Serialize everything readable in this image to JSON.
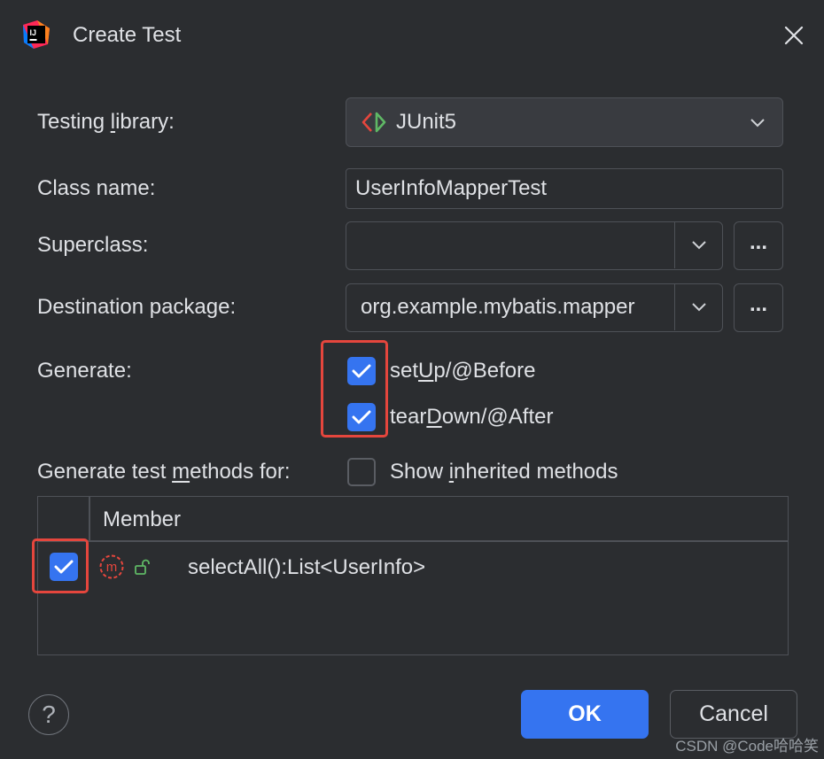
{
  "window": {
    "title": "Create Test"
  },
  "form": {
    "testing_library": {
      "label_pre": "Testing ",
      "label_u": "l",
      "label_post": "ibrary:",
      "value": "JUnit5"
    },
    "class_name": {
      "label": "Class name:",
      "value": "UserInfoMapperTest"
    },
    "superclass": {
      "label": "Superclass:",
      "value": "",
      "browse": "..."
    },
    "destination_package": {
      "label": "Destination package:",
      "value": "org.example.mybatis.mapper",
      "browse": "..."
    },
    "generate": {
      "label": "Generate:",
      "setup": {
        "pre": "set",
        "u": "U",
        "post": "p/@Before",
        "checked": true
      },
      "teardown": {
        "pre": "tear",
        "u": "D",
        "post": "own/@After",
        "checked": true
      }
    },
    "methods_for": {
      "label_pre": "Generate test ",
      "label_u": "m",
      "label_post": "ethods for:",
      "show_inherited": {
        "pre": "Show ",
        "u": "i",
        "post": "nherited methods",
        "checked": false
      }
    }
  },
  "table": {
    "header": "Member",
    "rows": [
      {
        "member": "selectAll():List<UserInfo>",
        "checked": true
      }
    ]
  },
  "buttons": {
    "ok": "OK",
    "cancel": "Cancel",
    "help": "?"
  },
  "watermark": "CSDN @Code哈哈笑",
  "colors": {
    "accent": "#3574f0",
    "highlight": "#e5463d",
    "background": "#2b2d30"
  }
}
